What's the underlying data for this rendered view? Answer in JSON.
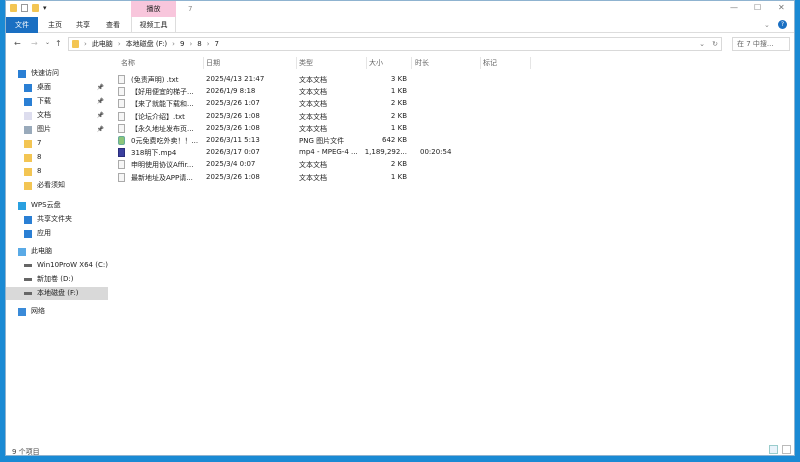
{
  "window": {
    "title": "7",
    "context_tab": "播放",
    "minimize": "—",
    "maximize": "☐",
    "close": "✕",
    "help": "?"
  },
  "ribbon": {
    "tabs": [
      "文件",
      "主页",
      "共享",
      "查看",
      "视频工具"
    ]
  },
  "address": {
    "crumbs": [
      "此电脑",
      "本地磁盘 (F:)",
      "9",
      "8",
      "7"
    ],
    "search_placeholder": "在 7 中搜..."
  },
  "nav": {
    "items": [
      {
        "label": "快速访问",
        "icon": "star-icon",
        "pinned": false
      },
      {
        "label": "桌面",
        "icon": "desktop-icon",
        "pinned": true
      },
      {
        "label": "下载",
        "icon": "download-icon",
        "pinned": true
      },
      {
        "label": "文档",
        "icon": "document-icon",
        "pinned": true
      },
      {
        "label": "图片",
        "icon": "picture-icon",
        "pinned": true
      },
      {
        "label": "7",
        "icon": "folder-icon",
        "pinned": false
      },
      {
        "label": "8",
        "icon": "folder-icon",
        "pinned": false
      },
      {
        "label": "8",
        "icon": "folder-icon",
        "pinned": false
      },
      {
        "label": "必看须知",
        "icon": "folder-icon",
        "pinned": false
      },
      {
        "label": "WPS云盘",
        "icon": "cloud-icon",
        "pinned": false
      },
      {
        "label": "共享文件夹",
        "icon": "share-icon",
        "pinned": false
      },
      {
        "label": "应用",
        "icon": "apps-icon",
        "pinned": false
      },
      {
        "label": "此电脑",
        "icon": "computer-icon",
        "pinned": false
      },
      {
        "label": "Win10ProW X64 (C:)",
        "icon": "drive-icon",
        "pinned": false
      },
      {
        "label": "新加卷 (D:)",
        "icon": "drive-icon",
        "pinned": false
      },
      {
        "label": "本地磁盘 (F:)",
        "icon": "drive-icon",
        "pinned": false,
        "selected": true
      },
      {
        "label": "网络",
        "icon": "network-icon",
        "pinned": false
      }
    ]
  },
  "columns": [
    "名称",
    "日期",
    "类型",
    "大小",
    "时长",
    "标记"
  ],
  "files": [
    {
      "name": "(免责声明) .txt",
      "date": "2025/4/13 21:47",
      "type": "文本文档",
      "size": "3 KB",
      "duration": "",
      "kind": "txt"
    },
    {
      "name": "【好用便宜的梯子...",
      "date": "2026/1/9 8:18",
      "type": "文本文档",
      "size": "1 KB",
      "duration": "",
      "kind": "txt"
    },
    {
      "name": "【来了就能下载和...",
      "date": "2025/3/26 1:07",
      "type": "文本文档",
      "size": "2 KB",
      "duration": "",
      "kind": "txt"
    },
    {
      "name": "【论坛介绍】.txt",
      "date": "2025/3/26 1:08",
      "type": "文本文档",
      "size": "2 KB",
      "duration": "",
      "kind": "txt"
    },
    {
      "name": "【永久地址发布页...",
      "date": "2025/3/26 1:08",
      "type": "文本文档",
      "size": "1 KB",
      "duration": "",
      "kind": "txt"
    },
    {
      "name": "0元免费吃外卖！！...",
      "date": "2026/3/11 5:13",
      "type": "PNG 图片文件",
      "size": "642 KB",
      "duration": "",
      "kind": "png"
    },
    {
      "name": "318明下.mp4",
      "date": "2026/3/17 0:07",
      "type": "mp4 - MPEG-4 ...",
      "size": "1,189,292...",
      "duration": "00:20:54",
      "kind": "mp4"
    },
    {
      "name": "申明使用协议Affir...",
      "date": "2025/3/4 0:07",
      "type": "文本文档",
      "size": "2 KB",
      "duration": "",
      "kind": "txt"
    },
    {
      "name": "最新地址及APP请...",
      "date": "2025/3/26 1:08",
      "type": "文本文档",
      "size": "1 KB",
      "duration": "",
      "kind": "txt"
    }
  ],
  "status": {
    "count": "9 个项目"
  }
}
